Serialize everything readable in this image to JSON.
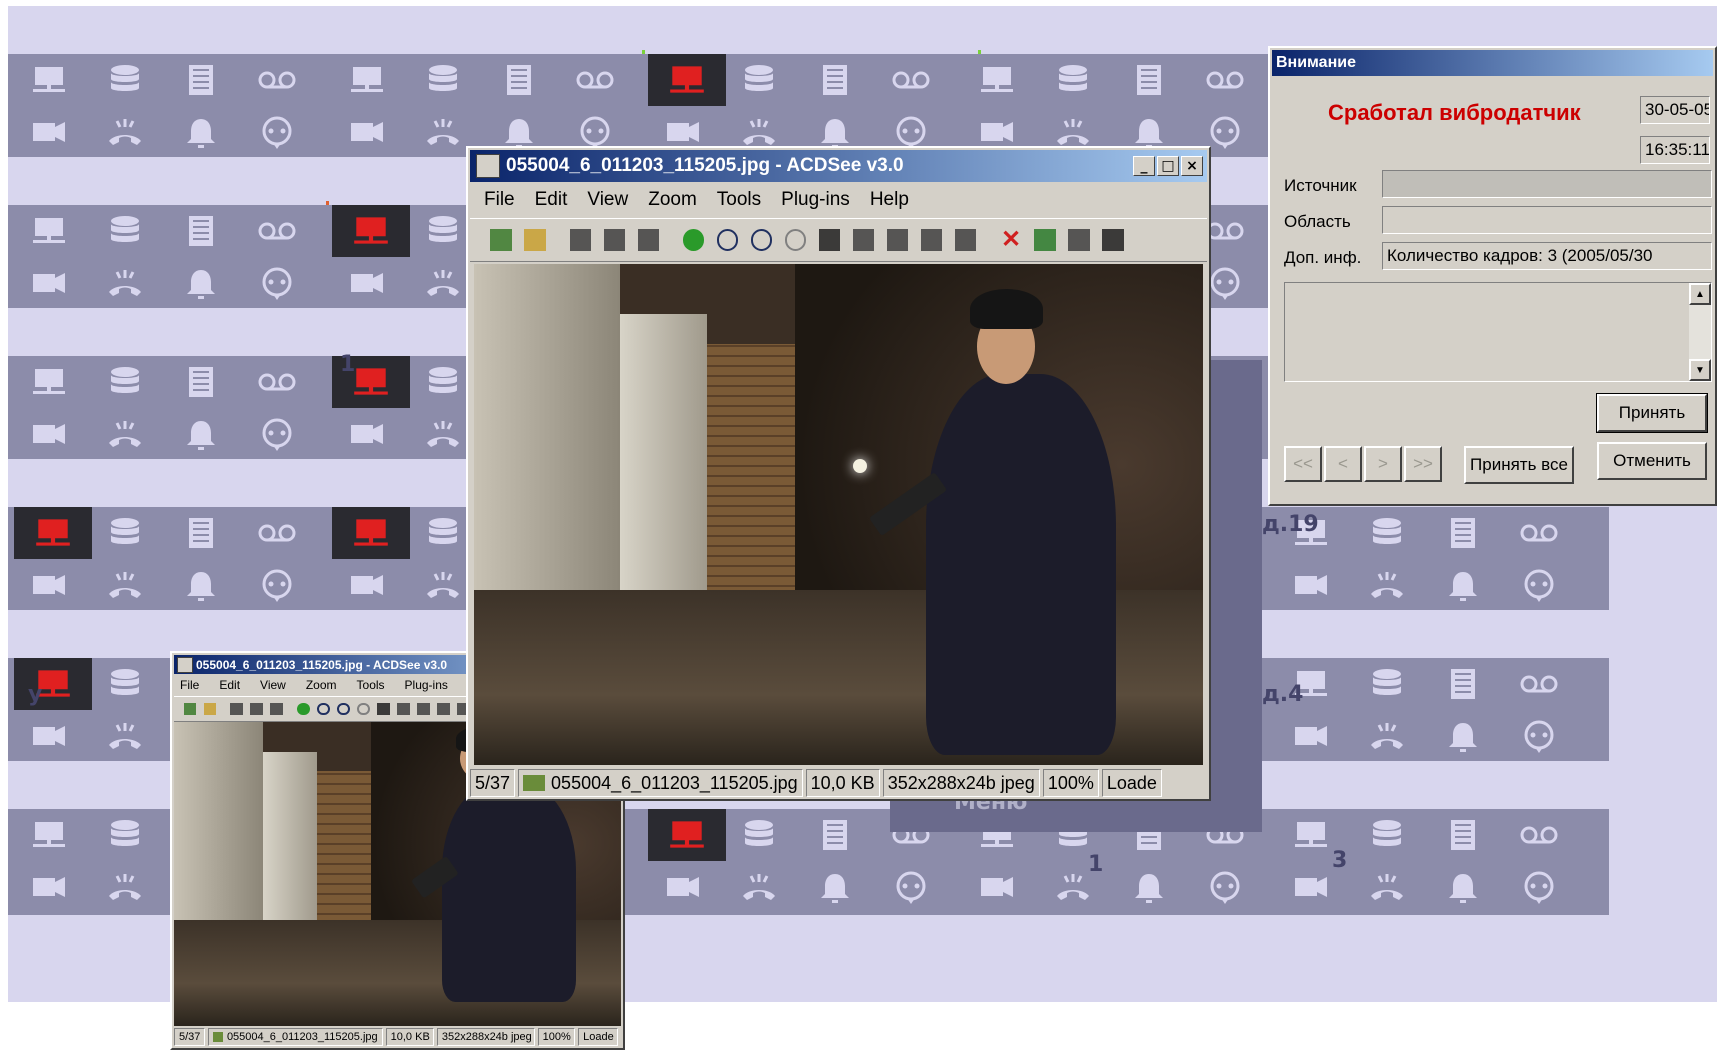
{
  "grid_labels": {
    "tile_a": "1",
    "tile_b": "у",
    "tile_c": "д.19",
    "tile_d": "у",
    "tile_e": "д.4",
    "tile_f": "1",
    "tile_g": "3",
    "menu_text": "Меню"
  },
  "acdsee_main": {
    "title": "055004_6_011203_115205.jpg - ACDSee v3.0",
    "menu": [
      "File",
      "Edit",
      "View",
      "Zoom",
      "Tools",
      "Plug-ins",
      "Help"
    ],
    "status": {
      "index": "5/37",
      "filename": "055004_6_011203_115205.jpg",
      "size": "10,0 KB",
      "format": "352x288x24b jpeg",
      "zoom": "100%",
      "state": "Loade"
    }
  },
  "acdsee_small": {
    "title": "055004_6_011203_115205.jpg - ACDSee v3.0",
    "menu": [
      "File",
      "Edit",
      "View",
      "Zoom",
      "Tools",
      "Plug-ins",
      "Help"
    ],
    "status": {
      "index": "5/37",
      "filename": "055004_6_011203_115205.jpg",
      "size": "10,0 KB",
      "format": "352x288x24b jpeg",
      "zoom": "100%",
      "state": "Loade"
    }
  },
  "dialog": {
    "title": "Внимание",
    "alert": "Сработал вибродатчик",
    "date": "30-05-05",
    "time": "16:35:11",
    "source_label": "Источник",
    "source_value": "",
    "area_label": "Область",
    "area_value": "",
    "info_label": "Доп. инф.",
    "info_value": "Количество кадров: 3 (2005/05/30",
    "nav": [
      "<<",
      "<",
      ">",
      ">>"
    ],
    "accept": "Принять",
    "accept_all": "Принять все",
    "cancel": "Отменить"
  },
  "colors": {
    "tile_bg": "#8c8caa",
    "tile_strip": "#d8d6ee",
    "alarm_icon": "#e02020",
    "dialog_alert": "#cc0000",
    "titlebar": "#0a246a"
  }
}
